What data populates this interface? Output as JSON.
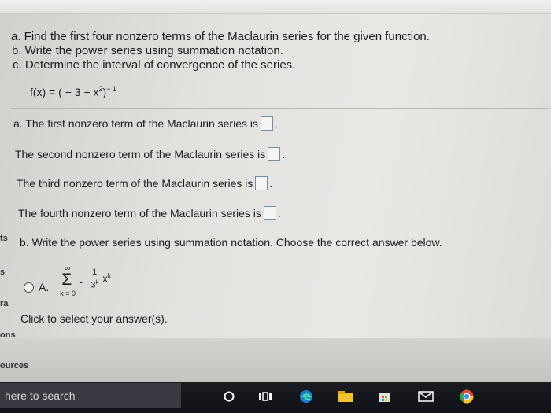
{
  "instructions": [
    "a. Find the first four nonzero terms of the Maclaurin series for the given function.",
    "b. Write the power series using summation notation.",
    "c. Determine the interval of convergence of the series."
  ],
  "function": {
    "lhs": "f(x) = ( − 3 + x",
    "exp2": "2",
    "rhs": ")",
    "exp_neg": "− 1"
  },
  "part_a": {
    "first": "a. The first nonzero term of the Maclaurin series is",
    "second": "The second nonzero term of the Maclaurin series is",
    "third": "The third nonzero term of the Maclaurin series is",
    "fourth": "The fourth nonzero term of the Maclaurin series is",
    "end_dot": "."
  },
  "part_b": {
    "prompt": "b. Write the power series using summation notation. Choose the correct answer below.",
    "option_a": {
      "label": "A.",
      "sum_upper": "∞",
      "sigma": "Σ",
      "sum_lower": "k = 0",
      "minus": "-",
      "numerator": "1",
      "denominator": "3",
      "den_exp": "k",
      "variable": "x",
      "var_exp": "k"
    }
  },
  "hint": "Click to select your answer(s).",
  "left_crumbs": [
    "ts",
    "s",
    "ra",
    "ons"
  ],
  "bottom_crumb": "ources",
  "taskbar": {
    "search_text": "here to search"
  }
}
